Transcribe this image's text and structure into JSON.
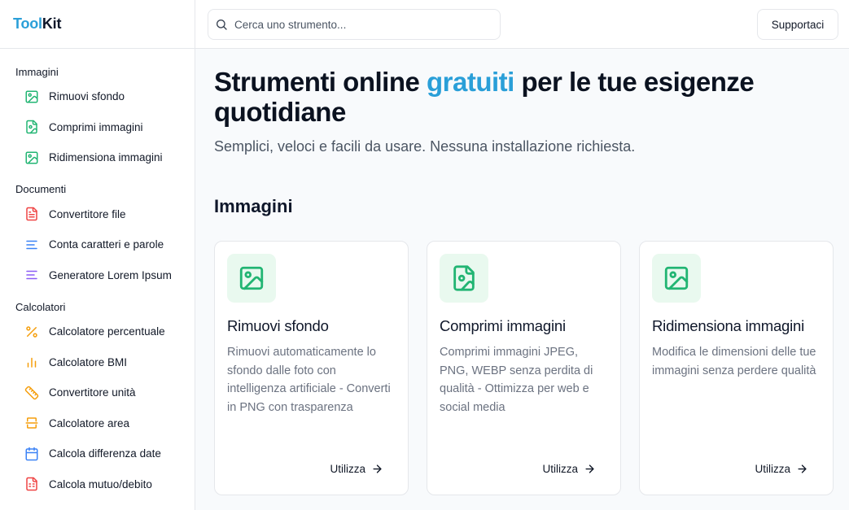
{
  "brand": {
    "part1": "Tool",
    "part2": "Kit",
    "accent_color": "#2a9fd8"
  },
  "search": {
    "placeholder": "Cerca uno strumento..."
  },
  "header": {
    "support_label": "Supportaci"
  },
  "sidebar": {
    "sections": [
      {
        "title": "Immagini",
        "items": [
          {
            "label": "Rimuovi sfondo",
            "icon": "image-icon",
            "color": "#22b573"
          },
          {
            "label": "Comprimi immagini",
            "icon": "file-image-icon",
            "color": "#22b573"
          },
          {
            "label": "Ridimensiona immagini",
            "icon": "image-icon",
            "color": "#22b573"
          }
        ]
      },
      {
        "title": "Documenti",
        "items": [
          {
            "label": "Convertitore file",
            "icon": "file-text-icon",
            "color": "#ef4444"
          },
          {
            "label": "Conta caratteri e parole",
            "icon": "text-lines-icon",
            "color": "#3b82f6"
          },
          {
            "label": "Generatore Lorem Ipsum",
            "icon": "text-lines-icon",
            "color": "#8b5cf6"
          }
        ]
      },
      {
        "title": "Calcolatori",
        "items": [
          {
            "label": "Calcolatore percentuale",
            "icon": "percent-icon",
            "color": "#f59e0b"
          },
          {
            "label": "Calcolatore BMI",
            "icon": "bar-chart-icon",
            "color": "#f59e0b"
          },
          {
            "label": "Convertitore unità",
            "icon": "ruler-icon",
            "color": "#f59e0b"
          },
          {
            "label": "Calcolatore area",
            "icon": "area-icon",
            "color": "#f59e0b"
          },
          {
            "label": "Calcola differenza date",
            "icon": "calendar-icon",
            "color": "#3b82f6"
          },
          {
            "label": "Calcola mutuo/debito",
            "icon": "calculator-file-icon",
            "color": "#ef4444"
          }
        ]
      }
    ]
  },
  "hero": {
    "title_part1": "Strumenti online ",
    "title_accent": "gratuiti",
    "title_part2": " per le tue esigenze quotidiane",
    "subtitle": "Semplici, veloci e facili da usare. Nessuna installazione richiesta."
  },
  "category": {
    "title": "Immagini"
  },
  "cards": [
    {
      "title": "Rimuovi sfondo",
      "description": "Rimuovi automaticamente lo sfondo dalle foto con intelligenza artificiale - Converti in PNG con trasparenza",
      "action": "Utilizza",
      "icon": "image-icon"
    },
    {
      "title": "Comprimi immagini",
      "description": "Comprimi immagini JPEG, PNG, WEBP senza perdita di qualità - Ottimizza per web e social media",
      "action": "Utilizza",
      "icon": "file-image-icon"
    },
    {
      "title": "Ridimensiona immagini",
      "description": "Modifica le dimensioni delle tue immagini senza perdere qualità",
      "action": "Utilizza",
      "icon": "image-icon"
    }
  ]
}
